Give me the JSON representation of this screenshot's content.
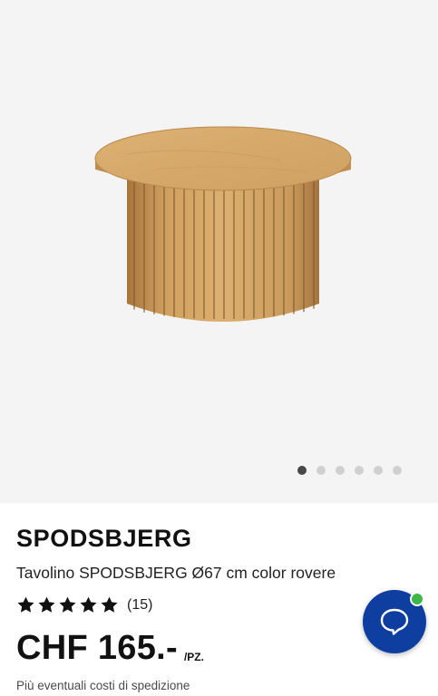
{
  "gallery": {
    "image_alt": "Tavolino SPODSBJERG",
    "dots_count": 6,
    "active_dot": 1,
    "colors": {
      "wood_light": "#d9ab6a",
      "wood_dark": "#a87a42",
      "background": "#f4f4f4"
    }
  },
  "product": {
    "name": "SPODSBJERG",
    "description": "Tavolino SPODSBJERG Ø67 cm color rovere",
    "rating": {
      "stars": 5,
      "reviews": "(15)"
    },
    "price": {
      "amount": "CHF 165.-",
      "unit": "/PZ."
    },
    "shipping_note": "Più eventuali costi di spedizione"
  },
  "chat": {
    "icon": "chat-bubble-icon",
    "status": "online",
    "button_color": "#0e3fa0",
    "status_color": "#3cb84a"
  }
}
